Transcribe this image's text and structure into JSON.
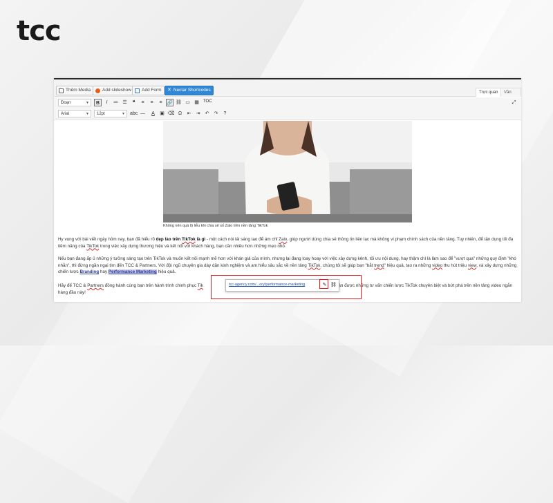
{
  "brand": {
    "logo": "tcc"
  },
  "media_bar": {
    "buttons": [
      "Thêm Media",
      "Add slideshow",
      "Add Form",
      "Nectar Shortcodes"
    ],
    "tabs": [
      "Trực quan",
      "Văn bản"
    ],
    "colors": {
      "nectar": "#2f87d5"
    }
  },
  "toolbar1": {
    "format_select": "Đoạn",
    "toc_label": "TOC"
  },
  "toolbar2": {
    "font_select": "Arial",
    "size_select": "12pt"
  },
  "image": {
    "caption": "Không nên quá lộ liễu khi chia sẻ số Zalo trên nền tảng TikTok"
  },
  "content": {
    "p1_a": "Hy vọng với bài viết ngày hôm nay, bạn đã hiểu rõ ",
    "p1_b": "dẹp lào trên ",
    "p1_c": "TikTok",
    "p1_d": " là gì",
    "p1_e": " - một cách nói lái sáng tạo để ám chỉ ",
    "p1_f": "Zalo",
    "p1_g": ", giúp người dùng chia sẻ thông tin liên lạc mà không vi phạm chính sách của nền tảng. Tuy nhiên, để tận dụng tối đa tiềm năng của ",
    "p1_h": "TikTok",
    "p1_i": " trong việc xây dựng thương hiệu và kết nối với khách hàng, bạn cần nhiều hơn những mẹo nhỏ.",
    "p2_a": "Nếu bạn đang ấp ủ những ý tưởng sáng tạo trên TikTok và muốn kết nối mạnh mẽ hơn với khán giả của mình, nhưng lại đang loay hoay với việc xây dựng kênh, tối ưu nội dung, hay thậm chí là làm sao để \"vượt qua\" những quy định \"khó nhằn\", thì đừng ngần ngại tìm đến TCC & Partners. Với đội ngũ chuyên gia dày dặn kinh nghiệm và am hiểu sâu sắc về nền tảng ",
    "p2_b": "TikTok",
    "p2_c": ", chúng tôi sẽ giúp bạn \"bắt ",
    "p2_d": "trend",
    "p2_e": "\" hiệu quả, tạo ra những ",
    "p2_f": "video",
    "p2_g": " thu hút triệu ",
    "p2_h": "view",
    "p2_i": ", và xây dựng những chiến lược ",
    "p2_j": "Branding",
    "p2_k": " hay ",
    "p2_l": "Performance Marketing",
    "p2_m": " hiệu quả.",
    "p3_a": "Hãy để TCC & ",
    "p3_b": "Partners",
    "p3_c": " đồng hành cùng bạn trên hành trình chinh phục ",
    "p3_d": "Tik",
    "p3_e": " hôm nay để nhận được những tư vấn chiến lược TikTok chuyên biệt và bứt phá trên nền tảng video ngắn hàng đầu này!"
  },
  "link_popup": {
    "url": "tcc-agency.com/...ory/performance-marketing"
  }
}
